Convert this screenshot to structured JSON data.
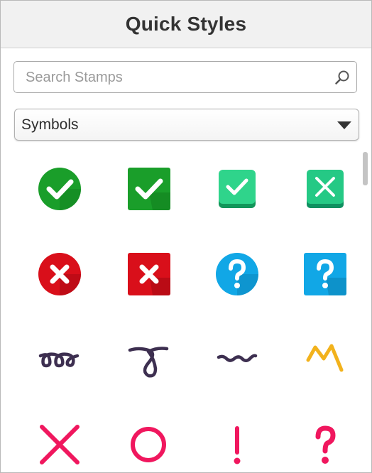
{
  "panel": {
    "title": "Quick Styles"
  },
  "search": {
    "placeholder": "Search Stamps",
    "value": ""
  },
  "category": {
    "selected": "Symbols"
  },
  "stamps": [
    {
      "icon": "check-circle-icon"
    },
    {
      "icon": "check-square-icon"
    },
    {
      "icon": "check-box-3d-icon"
    },
    {
      "icon": "x-box-3d-icon"
    },
    {
      "icon": "x-circle-icon"
    },
    {
      "icon": "x-square-icon"
    },
    {
      "icon": "question-circle-icon"
    },
    {
      "icon": "question-square-icon"
    },
    {
      "icon": "double-loop-squiggle-icon"
    },
    {
      "icon": "single-loop-squiggle-icon"
    },
    {
      "icon": "wave-squiggle-icon"
    },
    {
      "icon": "zigzag-mark-icon"
    },
    {
      "icon": "pink-x-icon"
    },
    {
      "icon": "pink-circle-icon"
    },
    {
      "icon": "pink-exclamation-icon"
    },
    {
      "icon": "pink-question-icon"
    }
  ],
  "colors": {
    "green": "#1a9e2a",
    "red": "#d90f1a",
    "blue": "#11a7e6",
    "teal": "#1ec27a",
    "purple": "#3d2f50",
    "yellow": "#f2b21c",
    "pink": "#f0175e"
  }
}
